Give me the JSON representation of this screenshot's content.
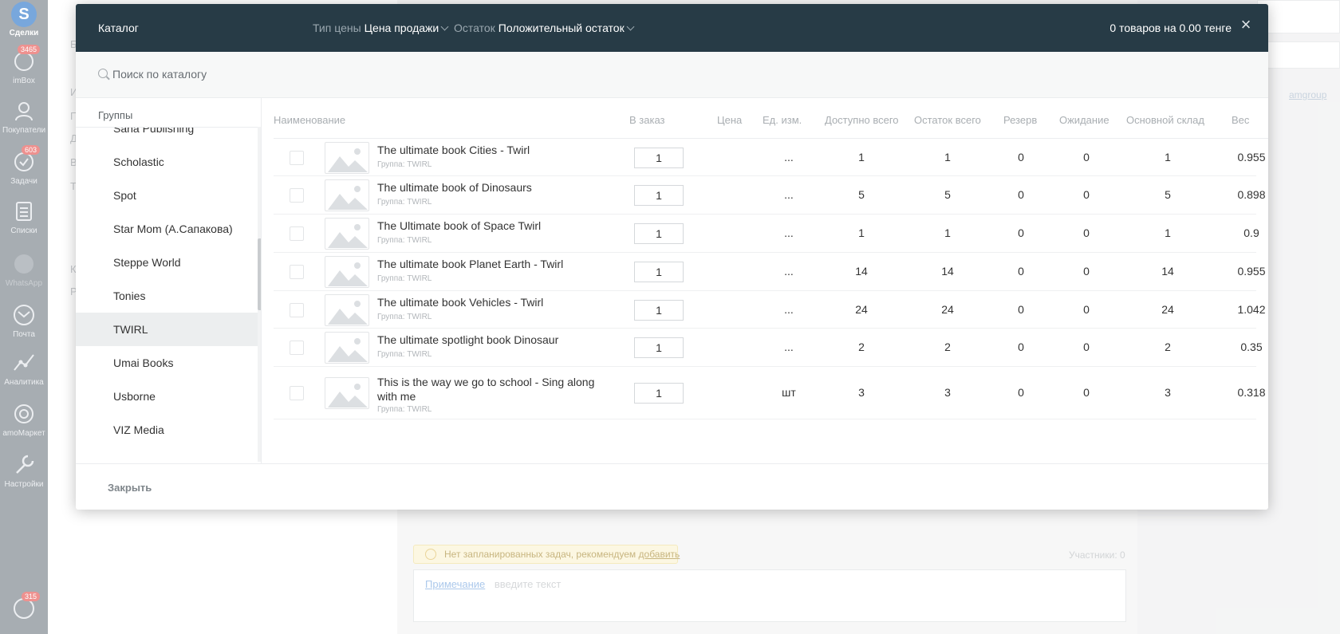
{
  "sidebar": {
    "items": [
      {
        "label": "Сделки",
        "badge": ""
      },
      {
        "label": "imBox",
        "badge": "3465"
      },
      {
        "label": "Покупатели",
        "badge": ""
      },
      {
        "label": "Задачи",
        "badge": "603"
      },
      {
        "label": "Списки",
        "badge": ""
      },
      {
        "label": "WhatsApp",
        "badge": ""
      },
      {
        "label": "Почта",
        "badge": ""
      },
      {
        "label": "Аналитика",
        "badge": ""
      },
      {
        "label": "amoМаркет",
        "badge": ""
      },
      {
        "label": "Настройки",
        "badge": ""
      }
    ],
    "notifications_badge": "315"
  },
  "background": {
    "left_letters": [
      "Б",
      "И",
      "П",
      "Д",
      "В",
      "Т",
      "К",
      "Р"
    ],
    "task_notice": "Нет запланированных задач, рекомендуем",
    "task_notice_link": "добавить",
    "participants": "Участники: 0",
    "note_link": "Примечание",
    "note_placeholder": "введите текст",
    "amgroup": "amgroup"
  },
  "modal": {
    "title": "Каталог",
    "price_type_label": "Тип цены",
    "price_type_value": "Цена продажи",
    "stock_label": "Остаток",
    "stock_value": "Положительный остаток",
    "summary": "0 товаров на 0.00 тенге",
    "close_icon": "×",
    "search_placeholder": "Поиск по каталогу",
    "groups_heading": "Группы",
    "groups": [
      "Sana Publishing",
      "Scholastic",
      "Spot",
      "Star Mom (А.Сапакова)",
      "Steppe World",
      "Tonies",
      "TWIRL",
      "Umai Books",
      "Usborne",
      "VIZ Media"
    ],
    "active_group": "TWIRL",
    "columns": {
      "name": "Наименование",
      "order": "В заказ",
      "price": "Цена",
      "unit": "Ед. изм.",
      "available": "Доступно всего",
      "stock": "Остаток всего",
      "reserve": "Резерв",
      "waiting": "Ожидание",
      "warehouse": "Основной склад",
      "weight": "Вес"
    },
    "products": [
      {
        "name": "The ultimate book Cities - Twirl",
        "group": "Группа: TWIRL",
        "qty": "1",
        "price": "",
        "unit": "...",
        "available": "1",
        "stock": "1",
        "reserve": "0",
        "waiting": "0",
        "warehouse": "1",
        "weight": "0.955"
      },
      {
        "name": "The ultimate book of Dinosaurs",
        "group": "Группа: TWIRL",
        "qty": "1",
        "price": "",
        "unit": "...",
        "available": "5",
        "stock": "5",
        "reserve": "0",
        "waiting": "0",
        "warehouse": "5",
        "weight": "0.898"
      },
      {
        "name": "The Ultimate book of Space Twirl",
        "group": "Группа: TWIRL",
        "qty": "1",
        "price": "",
        "unit": "...",
        "available": "1",
        "stock": "1",
        "reserve": "0",
        "waiting": "0",
        "warehouse": "1",
        "weight": "0.9"
      },
      {
        "name": "The ultimate book Planet Earth - Twirl",
        "group": "Группа: TWIRL",
        "qty": "1",
        "price": "",
        "unit": "...",
        "available": "14",
        "stock": "14",
        "reserve": "0",
        "waiting": "0",
        "warehouse": "14",
        "weight": "0.955"
      },
      {
        "name": "The ultimate book Vehicles - Twirl",
        "group": "Группа: TWIRL",
        "qty": "1",
        "price": "",
        "unit": "...",
        "available": "24",
        "stock": "24",
        "reserve": "0",
        "waiting": "0",
        "warehouse": "24",
        "weight": "1.042"
      },
      {
        "name": "The ultimate spotlight book Dinosaur",
        "group": "Группа: TWIRL",
        "qty": "1",
        "price": "",
        "unit": "...",
        "available": "2",
        "stock": "2",
        "reserve": "0",
        "waiting": "0",
        "warehouse": "2",
        "weight": "0.35"
      },
      {
        "name": "This is the way we go to school - Sing along with me",
        "group": "Группа: TWIRL",
        "qty": "1",
        "price": "",
        "unit": "шт",
        "available": "3",
        "stock": "3",
        "reserve": "0",
        "waiting": "0",
        "warehouse": "3",
        "weight": "0.318"
      }
    ],
    "footer_close": "Закрыть"
  },
  "colors": {
    "header_bg": "#273b46",
    "sidebar_bg": "#8a9299",
    "badge": "#e96d6a",
    "active_group_bg": "#eceeef"
  }
}
